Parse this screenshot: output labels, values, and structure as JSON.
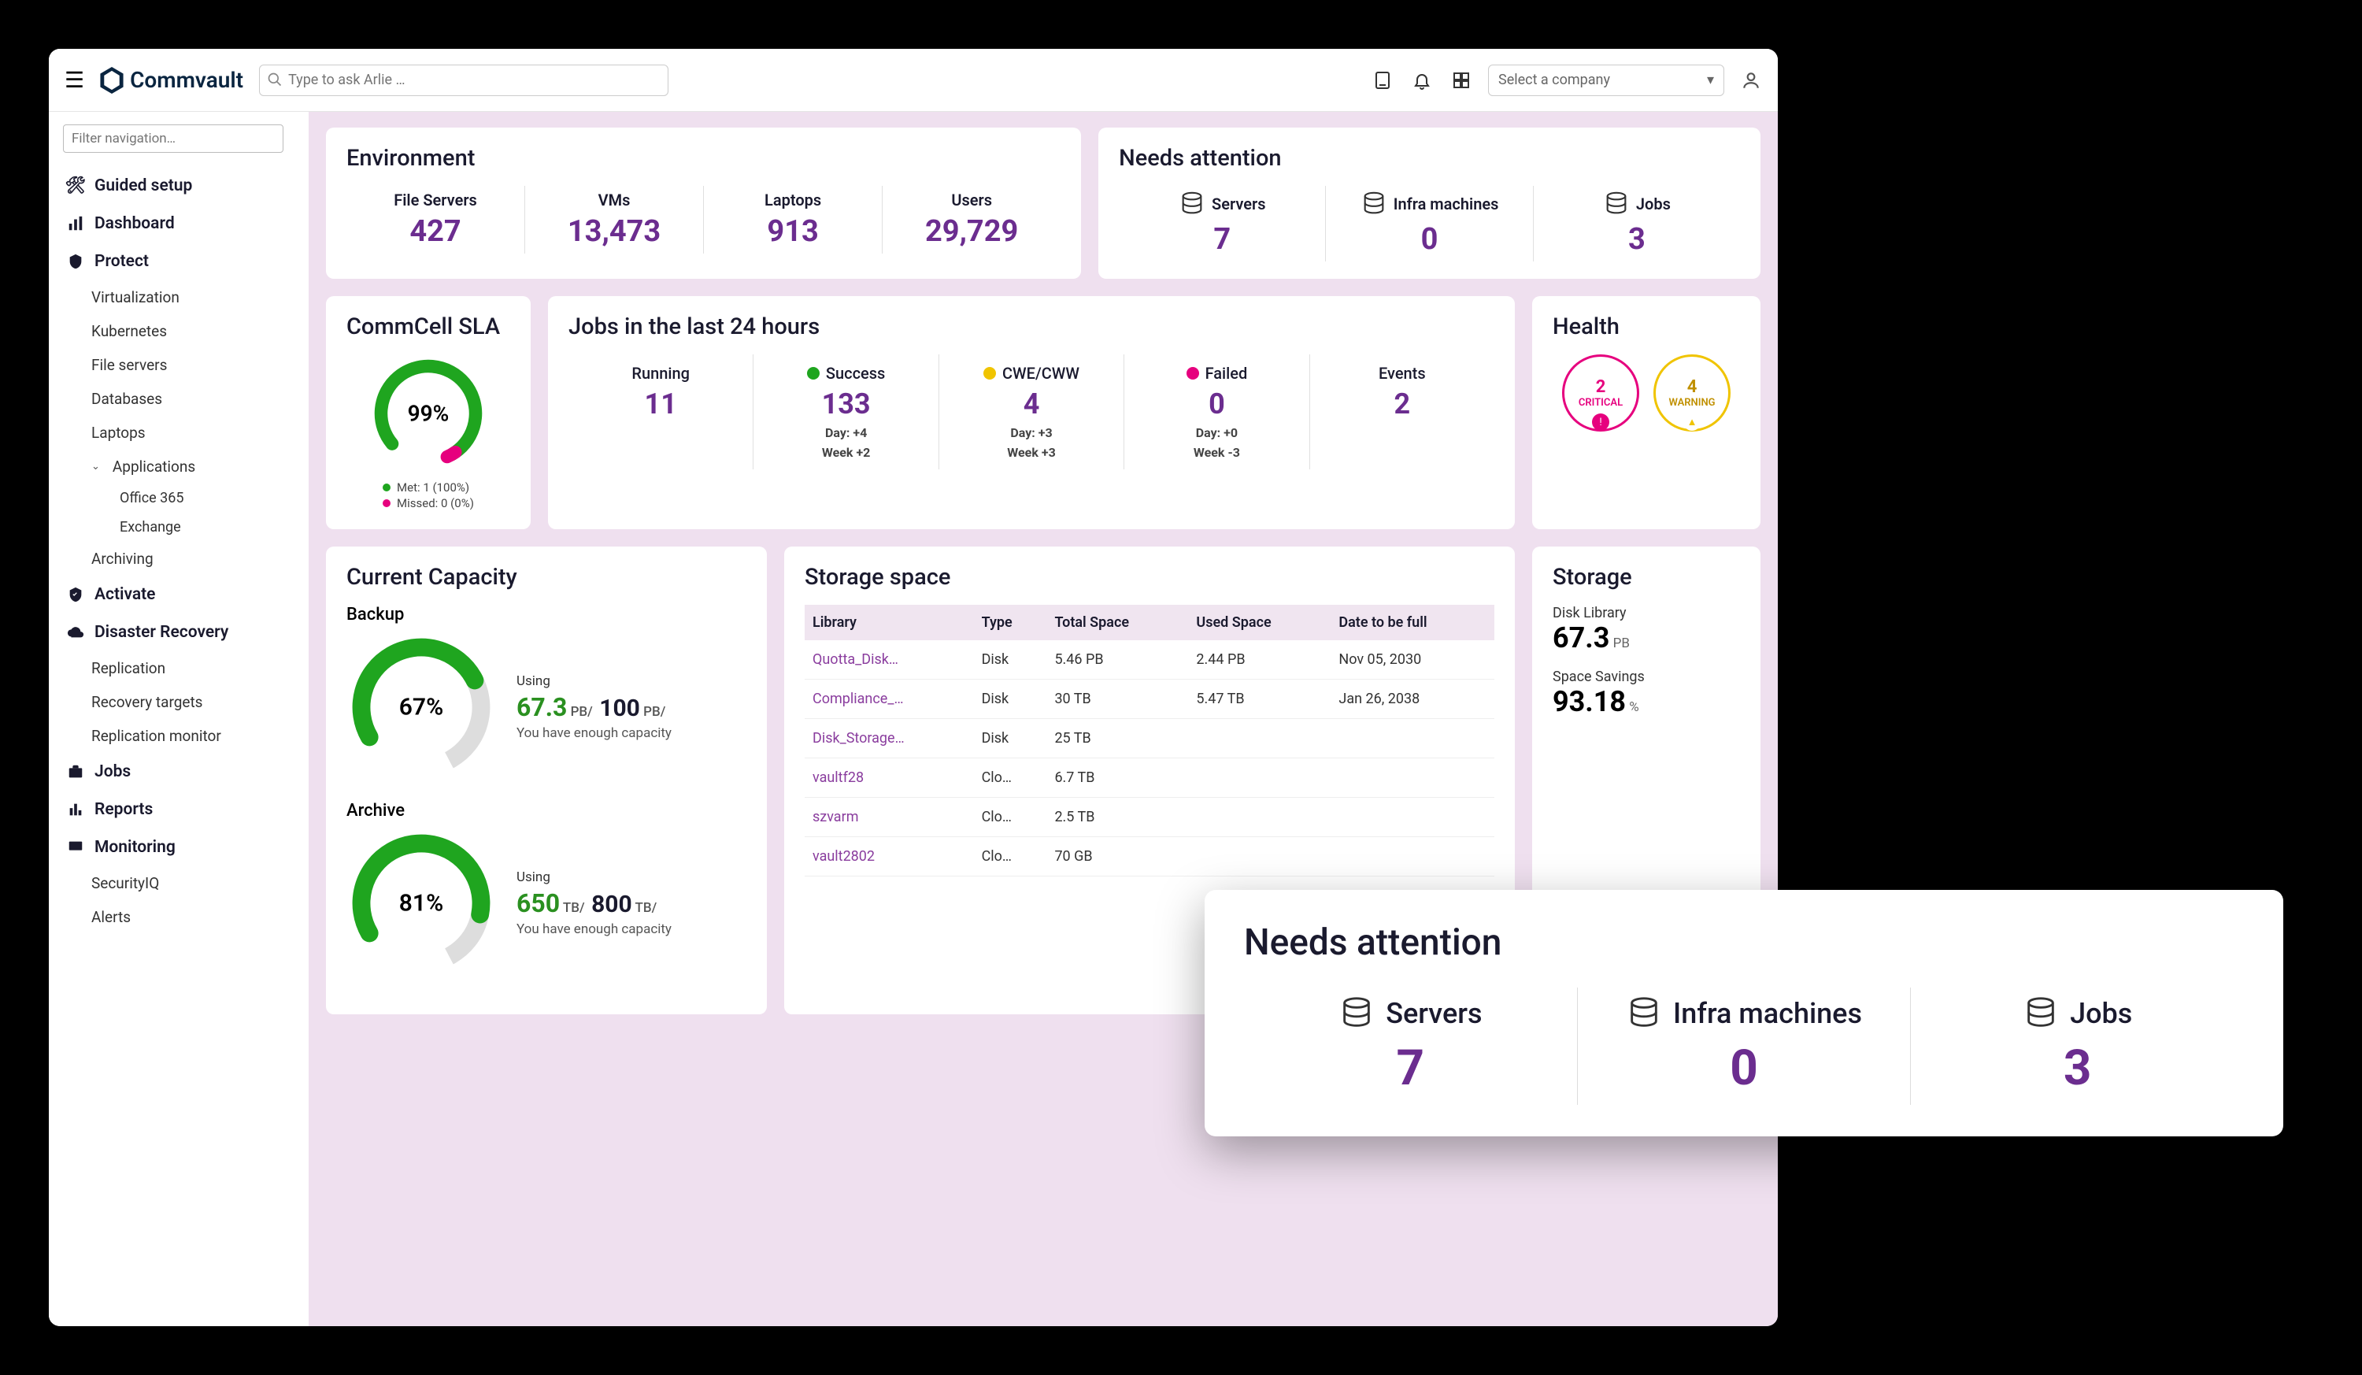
{
  "brand": "Commvault",
  "search_placeholder": "Type to ask Arlie …",
  "company_select": "Select a company",
  "filter_placeholder": "Filter navigation…",
  "nav": {
    "guided": "Guided setup",
    "dashboard": "Dashboard",
    "protect": "Protect",
    "virtualization": "Virtualization",
    "kubernetes": "Kubernetes",
    "fileservers": "File servers",
    "databases": "Databases",
    "laptops": "Laptops",
    "applications": "Applications",
    "office365": "Office 365",
    "exchange": "Exchange",
    "archiving": "Archiving",
    "activate": "Activate",
    "dr": "Disaster Recovery",
    "replication": "Replication",
    "recoverytargets": "Recovery targets",
    "replmonitor": "Replication monitor",
    "jobs": "Jobs",
    "reports": "Reports",
    "monitoring": "Monitoring",
    "securityiq": "SecurityIQ",
    "alerts": "Alerts"
  },
  "env": {
    "title": "Environment",
    "fileservers_label": "File Servers",
    "fileservers": "427",
    "vms_label": "VMs",
    "vms": "13,473",
    "laptops_label": "Laptops",
    "laptops": "913",
    "users_label": "Users",
    "users": "29,729"
  },
  "attention": {
    "title": "Needs attention",
    "servers_label": "Servers",
    "servers": "7",
    "infra_label": "Infra machines",
    "infra": "0",
    "jobs_label": "Jobs",
    "jobs": "3"
  },
  "sla": {
    "title": "CommCell SLA",
    "percent": "99%",
    "met": "Met: 1 (100%)",
    "missed": "Missed: 0 (0%)"
  },
  "jobs": {
    "title": "Jobs in the last 24 hours",
    "running_label": "Running",
    "running": "11",
    "success_label": "Success",
    "success": "133",
    "success_day": "Day:  +4",
    "success_week": "Week  +2",
    "cwe_label": "CWE/CWW",
    "cwe": "4",
    "cwe_day": "Day:  +3",
    "cwe_week": "Week  +3",
    "failed_label": "Failed",
    "failed": "0",
    "failed_day": "Day:  +0",
    "failed_week": "Week  -3",
    "events_label": "Events",
    "events": "2"
  },
  "health": {
    "title": "Health",
    "critical_n": "2",
    "critical_l": "CRITICAL",
    "warning_n": "4",
    "warning_l": "WARNING"
  },
  "capacity": {
    "title": "Current Capacity",
    "backup_title": "Backup",
    "backup_pct": "67%",
    "backup_using": "Using",
    "backup_cur": "67.3",
    "backup_cur_unit": " PB/",
    "backup_tot": "100",
    "backup_tot_unit": " PB/",
    "backup_note": "You have enough capacity",
    "archive_title": "Archive",
    "archive_pct": "81%",
    "archive_using": "Using",
    "archive_cur": "650",
    "archive_cur_unit": " TB/",
    "archive_tot": "800",
    "archive_tot_unit": " TB/",
    "archive_note": "You have enough capacity"
  },
  "storagespace": {
    "title": "Storage space",
    "h_library": "Library",
    "h_type": "Type",
    "h_total": "Total Space",
    "h_used": "Used Space",
    "h_date": "Date to be full",
    "r0": {
      "lib": "Quotta_Disk…",
      "type": "Disk",
      "total": "5.46 PB",
      "used": "2.44 PB",
      "date": "Nov 05, 2030"
    },
    "r1": {
      "lib": "Compliance_…",
      "type": "Disk",
      "total": "30 TB",
      "used": "5.47 TB",
      "date": "Jan 26, 2038"
    },
    "r2": {
      "lib": "Disk_Storage…",
      "type": "Disk",
      "total": "25 TB",
      "used": "",
      "date": ""
    },
    "r3": {
      "lib": "vaultf28",
      "type": "Clo…",
      "total": "6.7 TB",
      "used": "",
      "date": ""
    },
    "r4": {
      "lib": "szvarm",
      "type": "Clo…",
      "total": "2.5 TB",
      "used": "",
      "date": ""
    },
    "r5": {
      "lib": "vault2802",
      "type": "Clo…",
      "total": "70 GB",
      "used": "",
      "date": ""
    }
  },
  "storage": {
    "title": "Storage",
    "disk_label": "Disk Library",
    "disk_val": "67.3",
    "disk_unit": " PB",
    "savings_label": "Space Savings",
    "savings_val": "93.18",
    "savings_unit": " %"
  },
  "chart_data": [
    {
      "type": "pie",
      "title": "CommCell SLA",
      "series": [
        {
          "name": "Met",
          "value": 100,
          "color": "#1fa51f"
        },
        {
          "name": "Missed",
          "value": 0,
          "color": "#e6007e"
        }
      ],
      "center_label": "99%"
    },
    {
      "type": "pie",
      "title": "Backup capacity",
      "series": [
        {
          "name": "Used",
          "value": 67,
          "color": "#1fa51f"
        },
        {
          "name": "Free",
          "value": 33,
          "color": "#d8d8d8"
        }
      ],
      "center_label": "67%",
      "used": 67.3,
      "total": 100,
      "unit": "PB"
    },
    {
      "type": "pie",
      "title": "Archive capacity",
      "series": [
        {
          "name": "Used",
          "value": 81,
          "color": "#1fa51f"
        },
        {
          "name": "Free",
          "value": 19,
          "color": "#d8d8d8"
        }
      ],
      "center_label": "81%",
      "used": 650,
      "total": 800,
      "unit": "TB"
    }
  ]
}
